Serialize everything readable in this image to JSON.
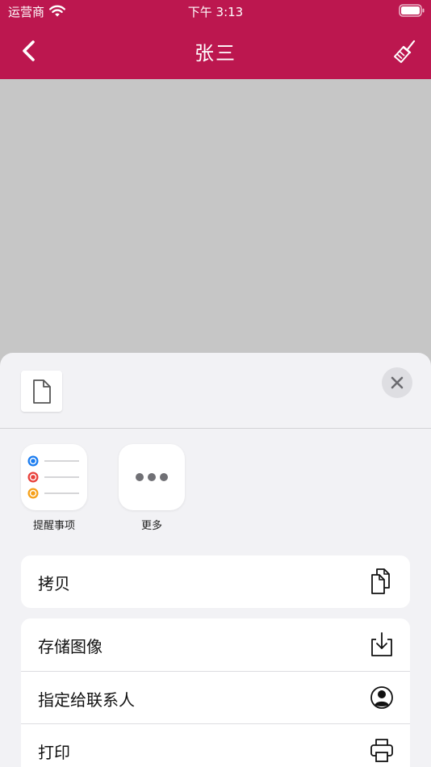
{
  "status_bar": {
    "carrier": "运营商",
    "time": "下午 3:13"
  },
  "nav": {
    "title": "张三",
    "back_icon": "chevron-left-icon",
    "clear_icon": "broom-icon"
  },
  "colors": {
    "brand": "#bc174f",
    "sheet_bg": "#f2f2f5",
    "dimmed_bg": "#c6c6c6",
    "reminder_blue": "#1a7cf0",
    "reminder_red": "#e8403a",
    "reminder_orange": "#f6a019"
  },
  "share_sheet": {
    "preview_icon": "document-icon",
    "close_icon": "close-icon",
    "apps": [
      {
        "label": "提醒事项",
        "icon": "reminders-icon"
      },
      {
        "label": "更多",
        "icon": "more-icon"
      }
    ],
    "actions_group1": [
      {
        "label": "拷贝",
        "icon": "copy-icon"
      }
    ],
    "actions_group2": [
      {
        "label": "存储图像",
        "icon": "save-image-icon"
      },
      {
        "label": "指定给联系人",
        "icon": "contact-icon"
      },
      {
        "label": "打印",
        "icon": "print-icon"
      }
    ]
  }
}
